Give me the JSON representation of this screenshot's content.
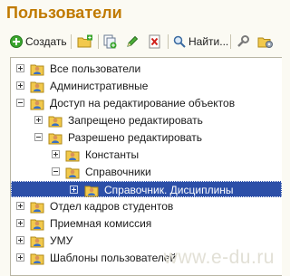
{
  "window": {
    "title": "Пользователи"
  },
  "toolbar": {
    "create_label": "Создать",
    "find_label": "Найти..."
  },
  "tree": {
    "items": [
      {
        "label": "Все пользователи"
      },
      {
        "label": "Административные"
      },
      {
        "label": "Доступ на редактирование объектов"
      },
      {
        "label": "Запрещено редактировать"
      },
      {
        "label": "Разрешено редактировать"
      },
      {
        "label": "Константы"
      },
      {
        "label": "Справочники"
      },
      {
        "label": "Справочник. Дисциплины"
      },
      {
        "label": "Отдел кадров студентов"
      },
      {
        "label": "Приемная комиссия"
      },
      {
        "label": "УМУ"
      },
      {
        "label": "Шаблоны пользователей"
      }
    ]
  },
  "watermark": "www.e-du.ru",
  "colors": {
    "title": "#c07a00",
    "selection": "#2c4fa8"
  }
}
